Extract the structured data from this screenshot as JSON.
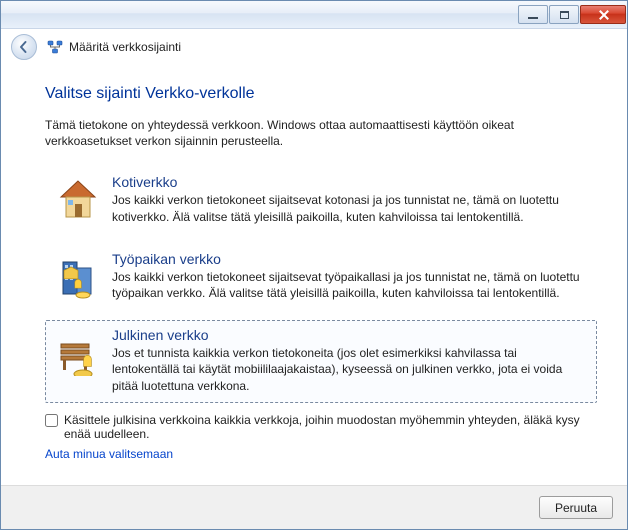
{
  "window": {
    "wizard_title": "Määritä verkkosijainti"
  },
  "main": {
    "heading": "Valitse sijainti Verkko-verkolle",
    "intro": "Tämä tietokone on yhteydessä verkkoon. Windows ottaa automaattisesti käyttöön oikeat verkkoasetukset verkon sijainnin perusteella."
  },
  "options": {
    "home": {
      "title": "Kotiverkko",
      "desc": "Jos kaikki verkon tietokoneet sijaitsevat kotonasi ja jos tunnistat ne, tämä on luotettu kotiverkko. Älä valitse tätä yleisillä paikoilla, kuten kahviloissa tai lentokentillä."
    },
    "work": {
      "title": "Työpaikan verkko",
      "desc": "Jos kaikki verkon tietokoneet sijaitsevat työpaikallasi ja jos tunnistat ne, tämä on luotettu työpaikan verkko. Älä valitse tätä yleisillä paikoilla, kuten kahviloissa tai lentokentillä."
    },
    "public": {
      "title": "Julkinen verkko",
      "desc": "Jos et tunnista kaikkia verkon tietokoneita (jos olet esimerkiksi kahvilassa tai lentokentällä tai käytät mobiililaajakaistaa), kyseessä on julkinen verkko, jota ei voida pitää luotettuna verkkona."
    }
  },
  "checkbox_label": "Käsittele julkisina verkkoina kaikkia verkkoja, joihin muodostan myöhemmin yhteyden, äläkä kysy enää uudelleen.",
  "help_link": "Auta minua valitsemaan",
  "footer": {
    "cancel_label": "Peruuta"
  }
}
